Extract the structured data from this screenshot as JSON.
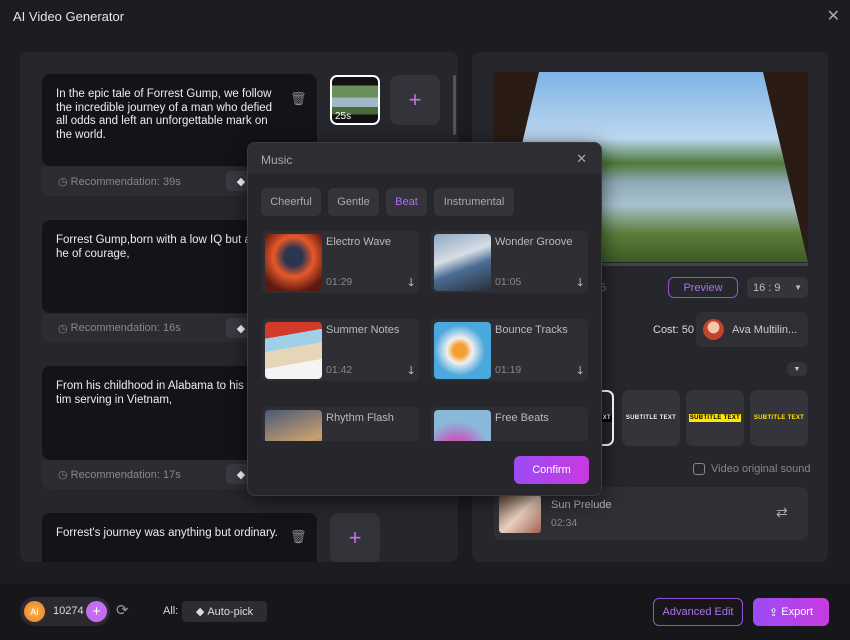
{
  "window": {
    "title": "AI Video Generator",
    "close_icon": "close-icon"
  },
  "scripts": [
    {
      "text": "In the epic tale of Forrest Gump, we follow the incredible journey of a man who defied all odds and left an unforgettable mark on the world.",
      "recommendation": "Recommendation: 39s",
      "clip_duration": "25s"
    },
    {
      "text": "Forrest Gump,born with a low IQ but a he of courage,",
      "recommendation": "Recommendation: 16s"
    },
    {
      "text": "From his childhood in Alabama to his tim serving in Vietnam,",
      "recommendation": "Recommendation: 17s"
    },
    {
      "text": "Forrest's journey was anything but ordinary."
    }
  ],
  "preview": {
    "partial_time": "5",
    "preview_label": "Preview",
    "aspect_ratio": "16 : 9",
    "cost": "Cost: 50",
    "voice": "Ava Multilin...",
    "subtitle_styles": [
      "SUBTITLE TEXT",
      "SUBTITLE TEXT",
      "SUBTITLE TEXT"
    ],
    "partial_style": "XT",
    "video_original_sound": "Video original sound",
    "video_original_sound_checked": false,
    "music": {
      "name": "Sun Prelude",
      "duration": "02:34"
    }
  },
  "music_modal": {
    "title": "Music",
    "tabs": [
      "Cheerful",
      "Gentle",
      "Beat",
      "Instrumental"
    ],
    "active_tab": "Beat",
    "tracks": [
      {
        "name": "Electro Wave",
        "duration": "01:29"
      },
      {
        "name": "Wonder Groove",
        "duration": "01:05"
      },
      {
        "name": "Summer Notes",
        "duration": "01:42"
      },
      {
        "name": "Bounce Tracks",
        "duration": "01:19"
      },
      {
        "name": "Rhythm Flash",
        "duration": ""
      },
      {
        "name": "Free Beats",
        "duration": ""
      }
    ],
    "confirm_label": "Confirm"
  },
  "footer": {
    "credits": "10274",
    "ai_badge": "AI",
    "all_label": "All:",
    "auto_pick": "Auto-pick",
    "advanced_edit": "Advanced Edit",
    "export": "Export"
  },
  "colors": {
    "accent": "#a855f7",
    "background": "#1c1c21",
    "panel": "#26262d"
  }
}
